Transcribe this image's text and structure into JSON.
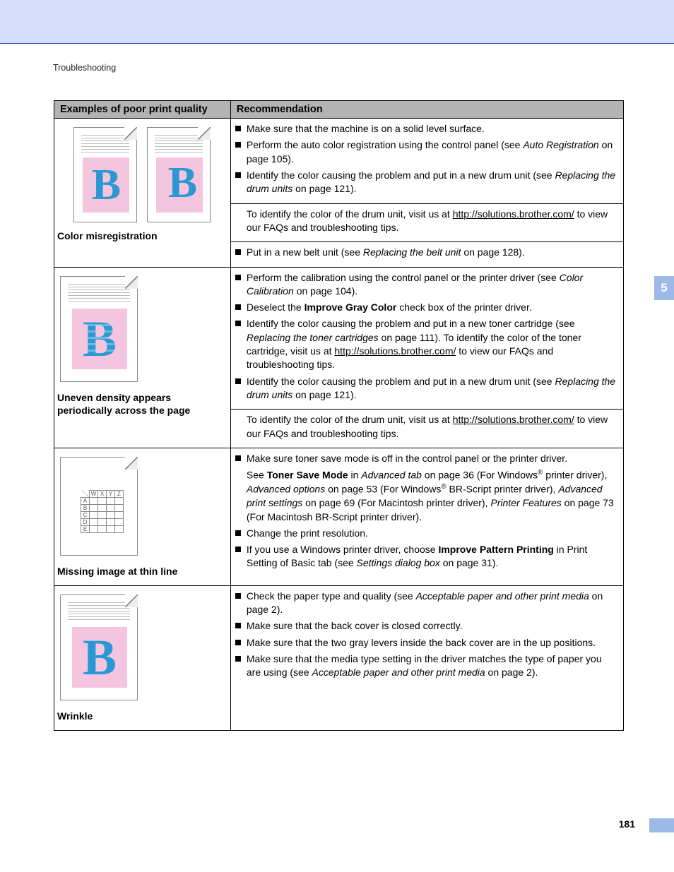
{
  "chapter": "Troubleshooting",
  "side_tab": "5",
  "page_number": "181",
  "headers": {
    "examples": "Examples of poor print quality",
    "recommendation": "Recommendation"
  },
  "rows": [
    {
      "label": "Color misregistration",
      "recs": [
        {
          "type": "bullet",
          "parts": [
            {
              "t": "Make sure that the machine is on a solid level surface."
            }
          ]
        },
        {
          "type": "bullet",
          "parts": [
            {
              "t": "Perform the auto color registration using the control panel (see "
            },
            {
              "t": "Auto Registration",
              "style": "i"
            },
            {
              "t": " on page 105)."
            }
          ]
        },
        {
          "type": "bullet",
          "parts": [
            {
              "t": "Identify the color causing the problem and put in a new drum unit (see "
            },
            {
              "t": "Replacing the drum units",
              "style": "i"
            },
            {
              "t": " on page 121)."
            }
          ]
        },
        {
          "type": "indent",
          "parts": [
            {
              "t": "To identify the color of the drum unit, visit us at "
            },
            {
              "t": "http://solutions.brother.com/",
              "style": "u"
            },
            {
              "t": " to view our FAQs and troubleshooting tips."
            }
          ]
        },
        {
          "type": "bullet",
          "parts": [
            {
              "t": "Put in a new belt unit (see "
            },
            {
              "t": "Replacing the belt unit",
              "style": "i"
            },
            {
              "t": " on page 128)."
            }
          ]
        }
      ]
    },
    {
      "label": "Uneven density appears periodically across the page",
      "recs": [
        {
          "type": "bullet",
          "parts": [
            {
              "t": "Perform the calibration using the control panel or the printer driver (see "
            },
            {
              "t": "Color Calibration",
              "style": "i"
            },
            {
              "t": " on page 104)."
            }
          ]
        },
        {
          "type": "bullet",
          "parts": [
            {
              "t": "Deselect the "
            },
            {
              "t": "Improve Gray Color",
              "style": "b"
            },
            {
              "t": " check box of the printer driver."
            }
          ]
        },
        {
          "type": "bullet",
          "parts": [
            {
              "t": "Identify the color causing the problem and put in a new toner cartridge (see "
            },
            {
              "t": "Replacing the toner cartridges",
              "style": "i"
            },
            {
              "t": " on page 111). To identify the color of the toner cartridge, visit us at "
            },
            {
              "t": "http://solutions.brother.com/",
              "style": "u"
            },
            {
              "t": " to view our FAQs and troubleshooting tips."
            }
          ]
        },
        {
          "type": "bullet",
          "parts": [
            {
              "t": "Identify the color causing the problem and put in a new drum unit (see "
            },
            {
              "t": "Replacing the drum units",
              "style": "i"
            },
            {
              "t": " on page 121)."
            }
          ]
        },
        {
          "type": "indent",
          "parts": [
            {
              "t": "To identify the color of the drum unit, visit us at "
            },
            {
              "t": "http://solutions.brother.com/",
              "style": "u"
            },
            {
              "t": " to view our FAQs and troubleshooting tips."
            }
          ]
        }
      ]
    },
    {
      "label": "Missing image at thin line",
      "recs": [
        {
          "type": "bullet",
          "parts": [
            {
              "t": "Make sure toner save mode is off in the control panel or the printer driver."
            }
          ]
        },
        {
          "type": "indent",
          "parts": [
            {
              "t": "See "
            },
            {
              "t": "Toner Save Mode",
              "style": "b"
            },
            {
              "t": " in "
            },
            {
              "t": "Advanced tab",
              "style": "i"
            },
            {
              "t": " on page 36 (For Windows"
            },
            {
              "t": "®",
              "style": "sup"
            },
            {
              "t": " printer driver), "
            },
            {
              "t": "Advanced options",
              "style": "i"
            },
            {
              "t": " on page 53 (For Windows"
            },
            {
              "t": "®",
              "style": "sup"
            },
            {
              "t": " BR-Script printer driver), "
            },
            {
              "t": "Advanced print settings",
              "style": "i"
            },
            {
              "t": " on page 69 (For Macintosh printer driver), "
            },
            {
              "t": "Printer Features",
              "style": "i"
            },
            {
              "t": " on page 73 (For Macintosh BR-Script printer driver)."
            }
          ]
        },
        {
          "type": "bullet",
          "parts": [
            {
              "t": "Change the print resolution."
            }
          ]
        },
        {
          "type": "bullet",
          "parts": [
            {
              "t": "If you use a Windows printer driver, choose "
            },
            {
              "t": "Improve Pattern Printing",
              "style": "b"
            },
            {
              "t": " in Print Setting of Basic tab (see "
            },
            {
              "t": "Settings dialog box",
              "style": "i"
            },
            {
              "t": " on page 31)."
            }
          ]
        }
      ]
    },
    {
      "label": "Wrinkle",
      "recs": [
        {
          "type": "bullet",
          "parts": [
            {
              "t": "Check the paper type and quality (see "
            },
            {
              "t": "Acceptable paper and other print media",
              "style": "i"
            },
            {
              "t": " on page 2)."
            }
          ]
        },
        {
          "type": "bullet",
          "parts": [
            {
              "t": "Make sure that the back cover is closed correctly."
            }
          ]
        },
        {
          "type": "bullet",
          "parts": [
            {
              "t": "Make sure that the two gray levers inside the back cover are in the up positions."
            }
          ]
        },
        {
          "type": "bullet",
          "parts": [
            {
              "t": "Make sure that the media type setting in the driver matches the type of paper you are using (see "
            },
            {
              "t": "Acceptable paper and other print media",
              "style": "i"
            },
            {
              "t": " on page 2)."
            }
          ]
        }
      ]
    }
  ]
}
